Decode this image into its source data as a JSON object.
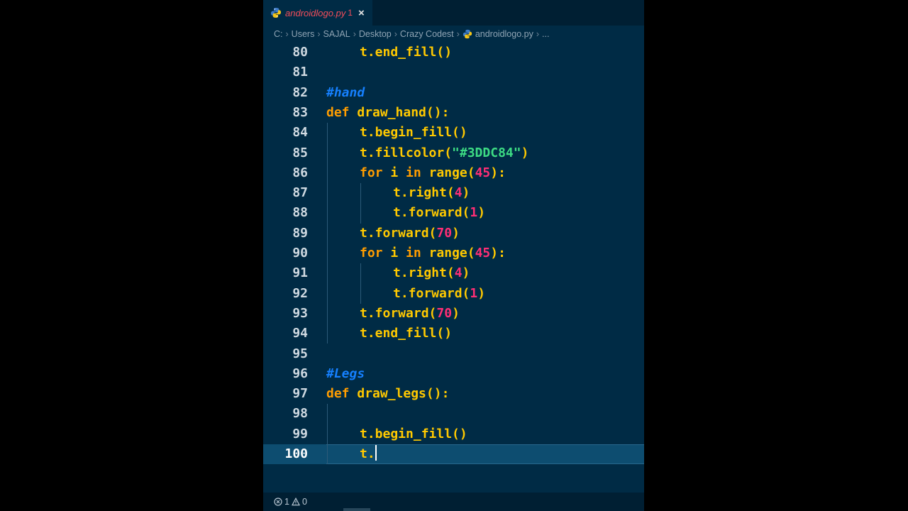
{
  "tab": {
    "filename": "androidlogo.py",
    "problem_count": "1",
    "close": "×"
  },
  "breadcrumb": [
    "C:",
    "Users",
    "SAJAL",
    "Desktop",
    "Crazy Codest",
    "androidlogo.py",
    "..."
  ],
  "lines": [
    {
      "n": "80",
      "indent": 1,
      "tokens": [
        {
          "t": "t.end_fill()",
          "c": "plain"
        }
      ]
    },
    {
      "n": "81",
      "indent": 0,
      "tokens": []
    },
    {
      "n": "82",
      "indent": 0,
      "tokens": [
        {
          "t": "#hand",
          "c": "cm"
        }
      ]
    },
    {
      "n": "83",
      "indent": 0,
      "tokens": [
        {
          "t": "def ",
          "c": "kw"
        },
        {
          "t": "draw_hand():",
          "c": "fn"
        }
      ]
    },
    {
      "n": "84",
      "indent": 1,
      "tokens": [
        {
          "t": "t.begin_fill()",
          "c": "plain"
        }
      ]
    },
    {
      "n": "85",
      "indent": 1,
      "tokens": [
        {
          "t": "t.fillcolor(",
          "c": "plain"
        },
        {
          "t": "\"#3DDC84\"",
          "c": "str"
        },
        {
          "t": ")",
          "c": "plain"
        }
      ]
    },
    {
      "n": "86",
      "indent": 1,
      "tokens": [
        {
          "t": "for ",
          "c": "kw"
        },
        {
          "t": "i ",
          "c": "plain"
        },
        {
          "t": "in ",
          "c": "kw"
        },
        {
          "t": "range(",
          "c": "plain"
        },
        {
          "t": "45",
          "c": "num"
        },
        {
          "t": "):",
          "c": "plain"
        }
      ]
    },
    {
      "n": "87",
      "indent": 2,
      "tokens": [
        {
          "t": "t.right(",
          "c": "plain"
        },
        {
          "t": "4",
          "c": "num"
        },
        {
          "t": ")",
          "c": "plain"
        }
      ]
    },
    {
      "n": "88",
      "indent": 2,
      "tokens": [
        {
          "t": "t.forward(",
          "c": "plain"
        },
        {
          "t": "1",
          "c": "num"
        },
        {
          "t": ")",
          "c": "plain"
        }
      ]
    },
    {
      "n": "89",
      "indent": 1,
      "tokens": [
        {
          "t": "t.forward(",
          "c": "plain"
        },
        {
          "t": "70",
          "c": "num"
        },
        {
          "t": ")",
          "c": "plain"
        }
      ]
    },
    {
      "n": "90",
      "indent": 1,
      "tokens": [
        {
          "t": "for ",
          "c": "kw"
        },
        {
          "t": "i ",
          "c": "plain"
        },
        {
          "t": "in ",
          "c": "kw"
        },
        {
          "t": "range(",
          "c": "plain"
        },
        {
          "t": "45",
          "c": "num"
        },
        {
          "t": "):",
          "c": "plain"
        }
      ]
    },
    {
      "n": "91",
      "indent": 2,
      "tokens": [
        {
          "t": "t.right(",
          "c": "plain"
        },
        {
          "t": "4",
          "c": "num"
        },
        {
          "t": ")",
          "c": "plain"
        }
      ]
    },
    {
      "n": "92",
      "indent": 2,
      "tokens": [
        {
          "t": "t.forward(",
          "c": "plain"
        },
        {
          "t": "1",
          "c": "num"
        },
        {
          "t": ")",
          "c": "plain"
        }
      ]
    },
    {
      "n": "93",
      "indent": 1,
      "tokens": [
        {
          "t": "t.forward(",
          "c": "plain"
        },
        {
          "t": "70",
          "c": "num"
        },
        {
          "t": ")",
          "c": "plain"
        }
      ]
    },
    {
      "n": "94",
      "indent": 1,
      "tokens": [
        {
          "t": "t.end_fill()",
          "c": "plain"
        }
      ]
    },
    {
      "n": "95",
      "indent": 0,
      "tokens": []
    },
    {
      "n": "96",
      "indent": 0,
      "tokens": [
        {
          "t": "#Legs",
          "c": "cm"
        }
      ]
    },
    {
      "n": "97",
      "indent": 0,
      "tokens": [
        {
          "t": "def ",
          "c": "kw"
        },
        {
          "t": "draw_legs():",
          "c": "fn"
        }
      ]
    },
    {
      "n": "98",
      "indent": 0,
      "tokens": []
    },
    {
      "n": "99",
      "indent": 1,
      "tokens": [
        {
          "t": "t.begin_fill()",
          "c": "plain"
        }
      ]
    },
    {
      "n": "100",
      "indent": 1,
      "tokens": [
        {
          "t": "t.",
          "c": "plain"
        }
      ],
      "active": true
    }
  ],
  "status": {
    "errors": "1",
    "warnings": "0"
  },
  "colors": {
    "editor_bg": "#002b45",
    "keyword": "#ff9d00",
    "function": "#ffc900",
    "number": "#ff2e75",
    "string": "#3ddc84",
    "comment": "#1580ff",
    "tab_active_text": "#f24d5a"
  }
}
